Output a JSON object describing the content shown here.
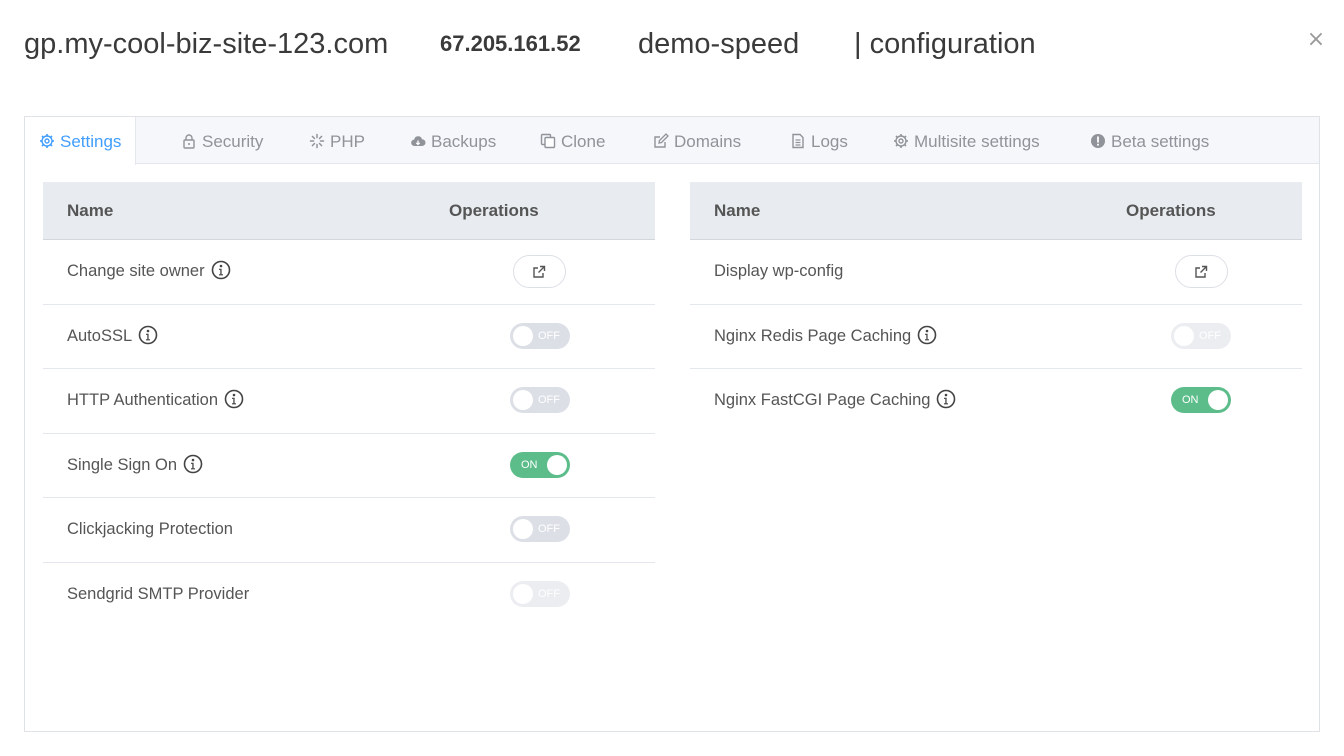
{
  "header": {
    "domain": "gp.my-cool-biz-site-123.com",
    "ip": "67.205.161.52",
    "site_name": "demo-speed",
    "section": "| configuration",
    "close_label": "×"
  },
  "tabs": [
    {
      "label": "Settings",
      "icon": "gear-icon",
      "active": true
    },
    {
      "label": "Security",
      "icon": "lock-icon"
    },
    {
      "label": "PHP",
      "icon": "spinner-icon"
    },
    {
      "label": "Backups",
      "icon": "cloud-icon"
    },
    {
      "label": "Clone",
      "icon": "copy-icon"
    },
    {
      "label": "Domains",
      "icon": "edit-icon"
    },
    {
      "label": "Logs",
      "icon": "document-icon"
    },
    {
      "label": "Multisite settings",
      "icon": "gear-icon"
    },
    {
      "label": "Beta settings",
      "icon": "alert-circle-icon"
    }
  ],
  "left_table": {
    "col_name": "Name",
    "col_ops": "Operations",
    "rows": [
      {
        "name": "Change site owner",
        "info": true,
        "op": "external-link"
      },
      {
        "name": "AutoSSL",
        "info": true,
        "op": "toggle",
        "state": "OFF"
      },
      {
        "name": "HTTP Authentication",
        "info": true,
        "op": "toggle",
        "state": "OFF"
      },
      {
        "name": "Single Sign On",
        "info": true,
        "op": "toggle",
        "state": "ON"
      },
      {
        "name": "Clickjacking Protection",
        "info": false,
        "op": "toggle",
        "state": "OFF"
      },
      {
        "name": "Sendgrid SMTP Provider",
        "info": false,
        "op": "toggle",
        "state": "OFF",
        "disabled": true
      }
    ]
  },
  "right_table": {
    "col_name": "Name",
    "col_ops": "Operations",
    "rows": [
      {
        "name": "Display wp-config",
        "info": false,
        "op": "external-link"
      },
      {
        "name": "Nginx Redis Page Caching",
        "info": true,
        "op": "toggle",
        "state": "OFF",
        "disabled": true
      },
      {
        "name": "Nginx FastCGI Page Caching",
        "info": true,
        "op": "toggle",
        "state": "ON"
      }
    ]
  },
  "colors": {
    "accent": "#409eff",
    "toggle_on": "#5cbd8a",
    "toggle_off": "#dcdfe6",
    "table_header_bg": "#e8ecf0"
  }
}
